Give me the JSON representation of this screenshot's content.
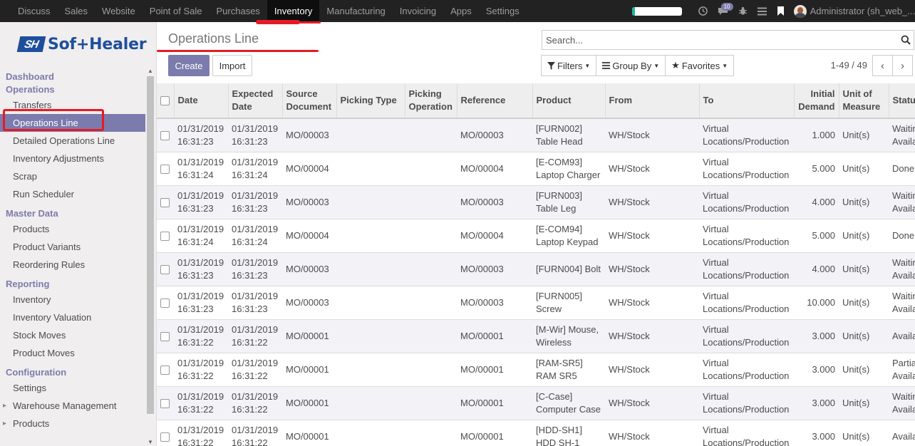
{
  "topmenu": [
    "Discuss",
    "Sales",
    "Website",
    "Point of Sale",
    "Purchases",
    "Inventory",
    "Manufacturing",
    "Invoicing",
    "Apps",
    "Settings"
  ],
  "active_app": "Inventory",
  "systray": {
    "progress_fraction": 0.07,
    "chat_count": "10",
    "user": "Administrator (sh_web_..."
  },
  "logo": {
    "mark": "SH",
    "brand": "Sof+Healer"
  },
  "sidebar": {
    "sections": [
      {
        "title": "Dashboard",
        "items": []
      },
      {
        "title": "Operations",
        "items": [
          "Transfers",
          "Operations Line",
          "Detailed Operations Line",
          "Inventory Adjustments",
          "Scrap",
          "Run Scheduler"
        ]
      },
      {
        "title": "Master Data",
        "items": [
          "Products",
          "Product Variants",
          "Reordering Rules"
        ]
      },
      {
        "title": "Reporting",
        "items": [
          "Inventory",
          "Inventory Valuation",
          "Stock Moves",
          "Product Moves"
        ]
      },
      {
        "title": "Configuration",
        "items": [
          "Settings",
          "Warehouse Management",
          "Products"
        ]
      }
    ],
    "active_item": "Operations Line"
  },
  "breadcrumb": "Operations Line",
  "buttons": {
    "create": "Create",
    "import": "Import"
  },
  "search": {
    "placeholder": "Search..."
  },
  "filters": {
    "filters": "Filters",
    "group_by": "Group By",
    "favorites": "Favorites"
  },
  "pager": "1-49 / 49",
  "table": {
    "headers": [
      "Date",
      "Expected Date",
      "Source Document",
      "Picking Type",
      "Picking Operation",
      "Reference",
      "Product",
      "From",
      "To",
      "Initial Demand",
      "Unit of Measure",
      "Status"
    ],
    "rows": [
      [
        "01/31/2019 16:31:23",
        "01/31/2019 16:31:23",
        "MO/00003",
        "",
        "",
        "MO/00003",
        "[FURN002] Table Head",
        "WH/Stock",
        "Virtual Locations/Production",
        "1.000",
        "Unit(s)",
        "Waiting Available"
      ],
      [
        "01/31/2019 16:31:24",
        "01/31/2019 16:31:24",
        "MO/00004",
        "",
        "",
        "MO/00004",
        "[E-COM93] Laptop Charger",
        "WH/Stock",
        "Virtual Locations/Production",
        "5.000",
        "Unit(s)",
        "Done"
      ],
      [
        "01/31/2019 16:31:23",
        "01/31/2019 16:31:23",
        "MO/00003",
        "",
        "",
        "MO/00003",
        "[FURN003] Table Leg",
        "WH/Stock",
        "Virtual Locations/Production",
        "4.000",
        "Unit(s)",
        "Waiting Available"
      ],
      [
        "01/31/2019 16:31:24",
        "01/31/2019 16:31:24",
        "MO/00004",
        "",
        "",
        "MO/00004",
        "[E-COM94] Laptop Keypad",
        "WH/Stock",
        "Virtual Locations/Production",
        "5.000",
        "Unit(s)",
        "Done"
      ],
      [
        "01/31/2019 16:31:23",
        "01/31/2019 16:31:23",
        "MO/00003",
        "",
        "",
        "MO/00003",
        "[FURN004] Bolt",
        "WH/Stock",
        "Virtual Locations/Production",
        "4.000",
        "Unit(s)",
        "Waiting Available"
      ],
      [
        "01/31/2019 16:31:23",
        "01/31/2019 16:31:23",
        "MO/00003",
        "",
        "",
        "MO/00003",
        "[FURN005] Screw",
        "WH/Stock",
        "Virtual Locations/Production",
        "10.000",
        "Unit(s)",
        "Waiting Available"
      ],
      [
        "01/31/2019 16:31:22",
        "01/31/2019 16:31:22",
        "MO/00001",
        "",
        "",
        "MO/00001",
        "[M-Wir] Mouse, Wireless",
        "WH/Stock",
        "Virtual Locations/Production",
        "3.000",
        "Unit(s)",
        "Available"
      ],
      [
        "01/31/2019 16:31:22",
        "01/31/2019 16:31:22",
        "MO/00001",
        "",
        "",
        "MO/00001",
        "[RAM-SR5] RAM SR5",
        "WH/Stock",
        "Virtual Locations/Production",
        "3.000",
        "Unit(s)",
        "Partially Available"
      ],
      [
        "01/31/2019 16:31:22",
        "01/31/2019 16:31:22",
        "MO/00001",
        "",
        "",
        "MO/00001",
        "[C-Case] Computer Case",
        "WH/Stock",
        "Virtual Locations/Production",
        "3.000",
        "Unit(s)",
        "Waiting Available"
      ],
      [
        "01/31/2019 16:31:22",
        "01/31/2019 16:31:22",
        "MO/00001",
        "",
        "",
        "MO/00001",
        "[HDD-SH1] HDD SH-1",
        "WH/Stock",
        "Virtual Locations/Production",
        "3.000",
        "Unit(s)",
        "Available"
      ]
    ]
  },
  "colors": {
    "accent": "#7c7bad",
    "highlight": "#e51b24",
    "navbar": "#222222"
  }
}
